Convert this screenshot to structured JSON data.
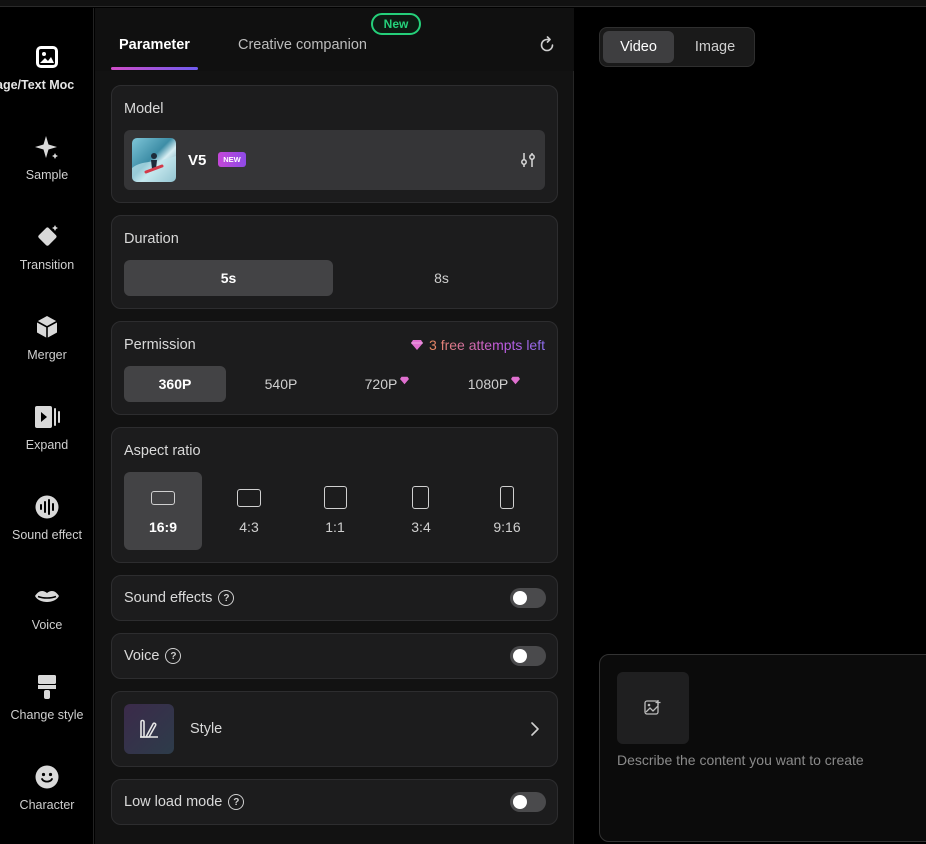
{
  "rail": {
    "items": [
      {
        "label": "age/Text Moc",
        "icon": "image-icon"
      },
      {
        "label": "Sample",
        "icon": "sparkle-icon"
      },
      {
        "label": "Transition",
        "icon": "diamond-icon"
      },
      {
        "label": "Merger",
        "icon": "cube-icon"
      },
      {
        "label": "Expand",
        "icon": "expand-video-icon"
      },
      {
        "label": "Sound effect",
        "icon": "soundwave-icon"
      },
      {
        "label": "Voice",
        "icon": "lips-icon"
      },
      {
        "label": "Change style",
        "icon": "paint-brush-icon"
      },
      {
        "label": "Character",
        "icon": "smiley-icon"
      }
    ]
  },
  "tabs": {
    "parameter": "Parameter",
    "companion": "Creative companion",
    "companion_badge": "New"
  },
  "model": {
    "title": "Model",
    "name": "V5",
    "badge": "NEW"
  },
  "duration": {
    "title": "Duration",
    "options": [
      "5s",
      "8s"
    ],
    "selected": "5s"
  },
  "permission": {
    "title": "Permission",
    "attempts": "3 free attempts left",
    "options": [
      "360P",
      "540P",
      "720P",
      "1080P"
    ],
    "selected": "360P"
  },
  "aspect": {
    "title": "Aspect ratio",
    "options": [
      "16:9",
      "4:3",
      "1:1",
      "3:4",
      "9:16"
    ],
    "selected": "16:9"
  },
  "sound_effects": {
    "label": "Sound effects",
    "enabled": false
  },
  "voice": {
    "label": "Voice",
    "enabled": false
  },
  "style": {
    "label": "Style"
  },
  "low_load": {
    "label": "Low load mode",
    "enabled": false
  },
  "preview": {
    "video_label": "Video",
    "image_label": "Image",
    "selected": "Video"
  },
  "prompt": {
    "placeholder": "Describe the content you want to create"
  },
  "colors": {
    "accent_green": "#25d07a",
    "gradient_pink": "#d04cc8",
    "gradient_violet": "#6f5cf0"
  }
}
